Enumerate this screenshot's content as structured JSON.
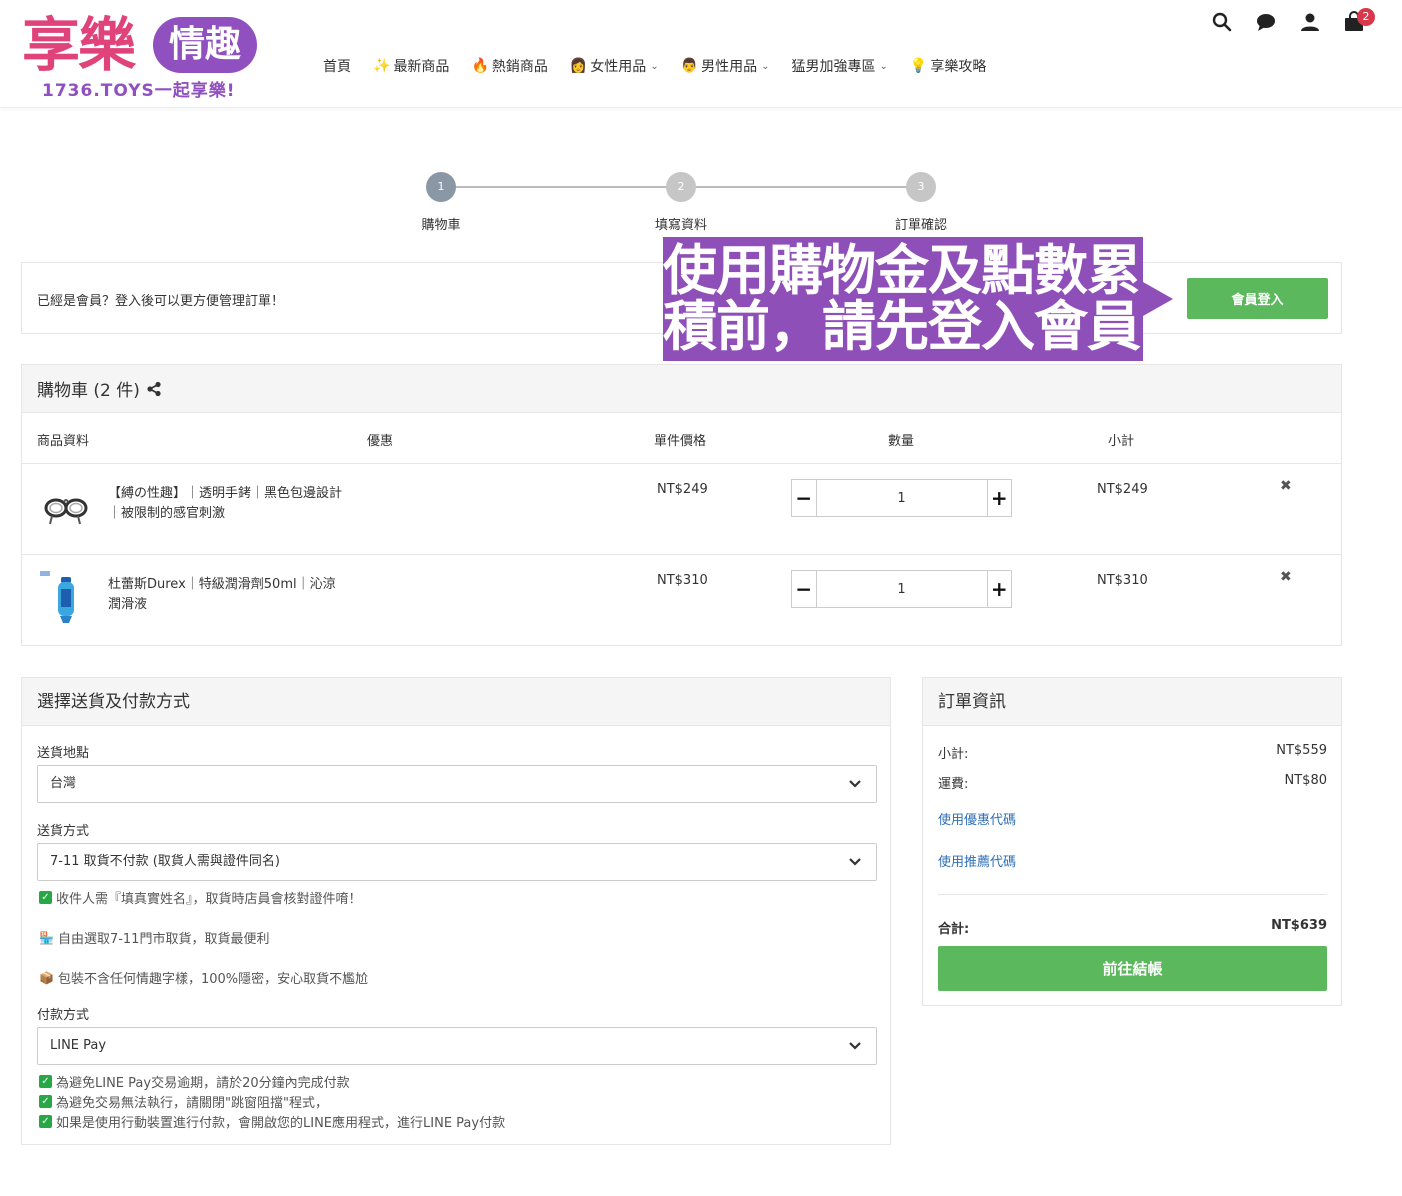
{
  "brand": {
    "logo_main": "享樂",
    "logo_pill": "情趣",
    "logo_sub": "1736.TOYS一起享樂!",
    "accent_pink": "#e0427a",
    "accent_purple": "#9150c0"
  },
  "nav": {
    "items": [
      {
        "label": "首頁",
        "emoji": ""
      },
      {
        "label": "最新商品",
        "emoji": "✨"
      },
      {
        "label": "熱銷商品",
        "emoji": "🔥"
      },
      {
        "label": "女性用品",
        "emoji": "👩",
        "dropdown": true
      },
      {
        "label": "男性用品",
        "emoji": "👨",
        "dropdown": true
      },
      {
        "label": "猛男加強專區",
        "emoji": "",
        "dropdown": true
      },
      {
        "label": "享樂攻略",
        "emoji": "💡"
      }
    ],
    "cart_count": "2",
    "icons": [
      "search-icon",
      "chat-icon",
      "user-icon",
      "cart-icon"
    ]
  },
  "steps": [
    {
      "num": "1",
      "label": "購物車",
      "active": true
    },
    {
      "num": "2",
      "label": "填寫資料",
      "active": false
    },
    {
      "num": "3",
      "label": "訂單確認",
      "active": false
    }
  ],
  "login_bar": {
    "text": "已經是會員？登入後可以更方便管理訂單！",
    "button": "會員登入",
    "callout": "使用購物金及點數累積前，請先登入會員"
  },
  "cart": {
    "title": "購物車 (2 件)",
    "columns": {
      "product": "商品資料",
      "discount": "優惠",
      "unit_price": "單件價格",
      "quantity": "數量",
      "subtotal": "小計"
    },
    "items": [
      {
        "name": "【縛の性趣】｜透明手銬｜黑色包邊設計｜被限制的感官刺激",
        "price": "NT$249",
        "qty": "1",
        "subtotal": "NT$249"
      },
      {
        "name": "杜蕾斯Durex｜特級潤滑劑50ml｜沁涼潤滑液",
        "price": "NT$310",
        "qty": "1",
        "subtotal": "NT$310"
      }
    ]
  },
  "shipping": {
    "title": "選擇送貨及付款方式",
    "location_label": "送貨地點",
    "location_value": "台灣",
    "method_label": "送貨方式",
    "method_value": "7-11 取貨不付款 (取貨人需與證件同名)",
    "method_notes": [
      "收件人需『填真實姓名』，取貨時店員會核對證件唷！",
      "自由選取7-11門市取貨，取貨最便利",
      "包裝不含任何情趣字樣，100%隱密，安心取貨不尷尬"
    ],
    "payment_label": "付款方式",
    "payment_value": "LINE Pay",
    "payment_notes": [
      "為避免LINE Pay交易逾期，請於20分鐘內完成付款",
      "為避免交易無法執行，請關閉\"跳窗阻擋\"程式，",
      "如果是使用行動裝置進行付款，會開啟您的LINE應用程式，進行LINE Pay付款"
    ]
  },
  "order": {
    "title": "訂單資訊",
    "subtotal_label": "小計:",
    "subtotal_value": "NT$559",
    "shipping_label": "運費:",
    "shipping_value": "NT$80",
    "coupon_link": "使用優惠代碼",
    "referral_link": "使用推薦代碼",
    "total_label": "合計:",
    "total_value": "NT$639",
    "checkout_button": "前往結帳"
  }
}
